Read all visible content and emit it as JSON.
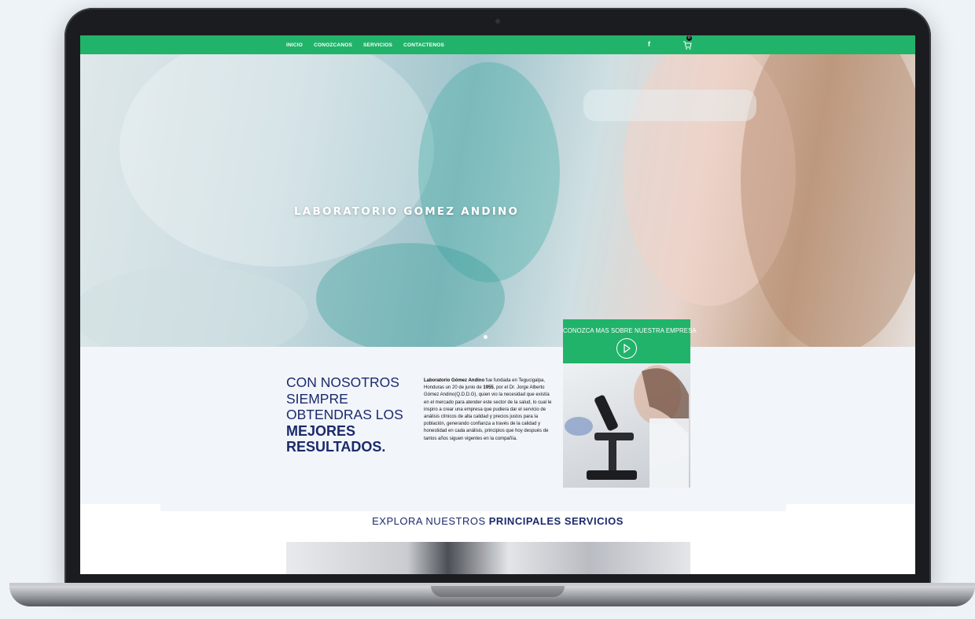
{
  "nav": {
    "items": [
      {
        "label": "INICIO"
      },
      {
        "label": "CONOZCANOS"
      },
      {
        "label": "SERVICIOS"
      },
      {
        "label": "CONTACTENOS"
      }
    ],
    "facebook_label": "f",
    "cart_count": "0"
  },
  "hero": {
    "title": "LABORATORIO GOMEZ ANDINO"
  },
  "promo": {
    "title": "CONOZCA MAS SOBRE NUESTRA EMPRESA"
  },
  "about": {
    "headline_line1": "CON NOSOTROS",
    "headline_line2": "SIEMPRE",
    "headline_line3": "OBTENDRAS LOS",
    "headline_strong1": "MEJORES",
    "headline_strong2": "RESULTADOS.",
    "text_company": "Laboratorio Gómez Andino",
    "text_part1": " fue fundada en Tegucigalpa, Honduras un 20 de junio de ",
    "text_year": "1955",
    "text_part2": ", por el Dr. Jorge Alberto Gómez Andino(Q.D.D.G), quien vio la necesidad que existía en el mercado para atender este sector de la salud, lo cual le inspiro a crear una empresa que pudiera dar el servicio de análisis clínicos de alta calidad y precios justos para la población, generando confianza a través de la calidad y honestidad en cada análisis, principios que hoy después de tantos años siguen vigentes en la compañía."
  },
  "services": {
    "title_prefix": "EXPLORA NUESTROS ",
    "title_strong": "PRINCIPALES SERVICIOS"
  },
  "colors": {
    "brand_green": "#21b36a",
    "headline_blue": "#1b2a6b"
  }
}
